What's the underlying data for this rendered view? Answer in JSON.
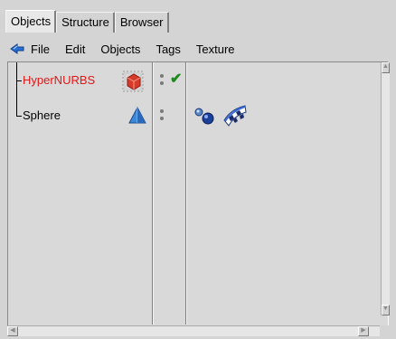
{
  "tabs": [
    {
      "label": "Objects",
      "active": true
    },
    {
      "label": "Structure",
      "active": false
    },
    {
      "label": "Browser",
      "active": false
    }
  ],
  "menu": {
    "icon": "manager-arrow-icon",
    "items": [
      "File",
      "Edit",
      "Objects",
      "Tags",
      "Texture"
    ]
  },
  "objects": [
    {
      "name": "HyperNURBS",
      "color": "#e01818",
      "icon": "hypernurbs-cube-icon",
      "enabled_check": "✔",
      "tags": []
    },
    {
      "name": "Sphere",
      "color": "#000000",
      "icon": "sphere-cone-icon",
      "enabled_check": "",
      "tags": [
        "phong-tag-icon",
        "texture-tag-icon"
      ]
    }
  ],
  "scrollbars": {
    "up": "▲",
    "down": "▼",
    "left": "◀",
    "right": "▶"
  },
  "colors": {
    "selected_object_text": "#e01818",
    "check": "#1e8a1e"
  }
}
